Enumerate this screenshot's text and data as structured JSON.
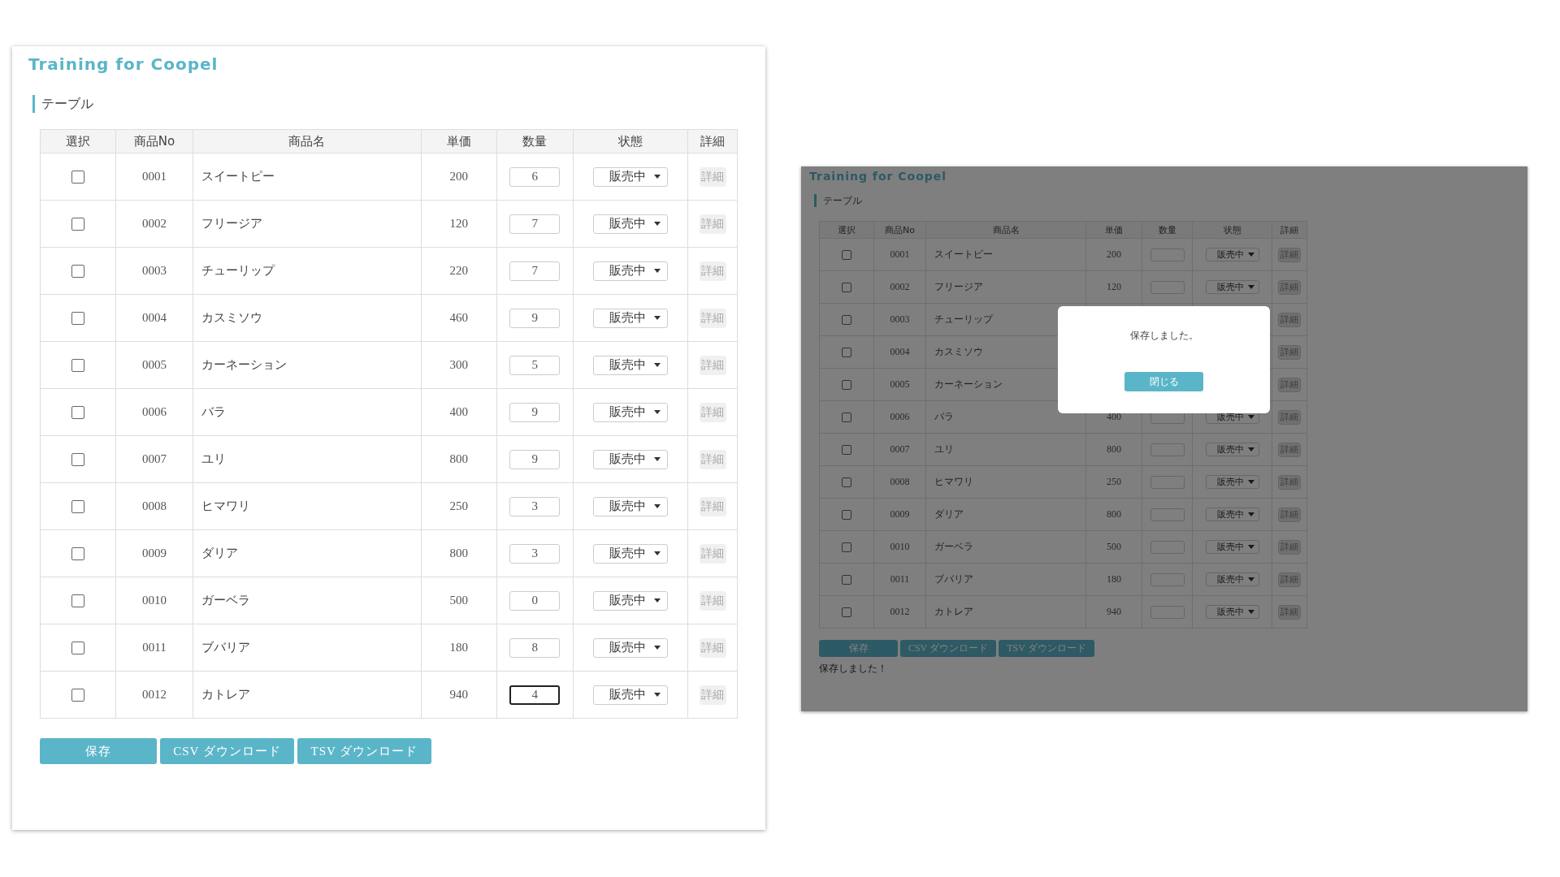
{
  "pages": [
    {
      "title": "Training for Coopel",
      "section": "テーブル",
      "columns": [
        "選択",
        "商品No",
        "商品名",
        "単価",
        "数量",
        "状態",
        "詳細"
      ],
      "rows": [
        {
          "kind": "full",
          "checked": false,
          "no": "0001",
          "name": "スイートピー",
          "price": "200",
          "quantity": "6",
          "focused": false,
          "status": "販売中",
          "detail": "詳細",
          "disabled": true
        },
        {
          "kind": "full",
          "checked": false,
          "no": "0002",
          "name": "フリージア",
          "price": "120",
          "quantity": "7",
          "focused": false,
          "status": "販売中",
          "detail": "詳細",
          "disabled": true
        },
        {
          "kind": "full",
          "checked": false,
          "no": "0003",
          "name": "チューリップ",
          "price": "220",
          "quantity": "7",
          "focused": false,
          "status": "販売中",
          "detail": "詳細",
          "disabled": true
        },
        {
          "kind": "full",
          "checked": false,
          "no": "0004",
          "name": "カスミソウ",
          "price": "460",
          "quantity": "9",
          "focused": false,
          "status": "販売中",
          "detail": "詳細",
          "disabled": true
        },
        {
          "kind": "full",
          "checked": false,
          "no": "0005",
          "name": "カーネーション",
          "price": "300",
          "quantity": "5",
          "focused": false,
          "status": "販売中",
          "detail": "詳細",
          "disabled": true
        },
        {
          "kind": "full",
          "checked": false,
          "no": "0006",
          "name": "バラ",
          "price": "400",
          "quantity": "9",
          "focused": false,
          "status": "販売中",
          "detail": "詳細",
          "disabled": true
        },
        {
          "kind": "full",
          "checked": false,
          "no": "0007",
          "name": "ユリ",
          "price": "800",
          "quantity": "9",
          "focused": false,
          "status": "販売中",
          "detail": "詳細",
          "disabled": true
        },
        {
          "kind": "full",
          "checked": false,
          "no": "0008",
          "name": "ヒマワリ",
          "price": "250",
          "quantity": "3",
          "focused": false,
          "status": "販売中",
          "detail": "詳細",
          "disabled": true
        },
        {
          "kind": "full",
          "checked": false,
          "no": "0009",
          "name": "ダリア",
          "price": "800",
          "quantity": "3",
          "focused": false,
          "status": "販売中",
          "detail": "詳細",
          "disabled": true
        },
        {
          "kind": "full",
          "checked": false,
          "no": "0010",
          "name": "ガーベラ",
          "price": "500",
          "quantity": "0",
          "focused": false,
          "status": "販売中",
          "detail": "詳細",
          "disabled": true
        },
        {
          "kind": "full",
          "checked": false,
          "no": "0011",
          "name": "ブバリア",
          "price": "180",
          "quantity": "8",
          "focused": false,
          "status": "販売中",
          "detail": "詳細",
          "disabled": true
        },
        {
          "kind": "full",
          "checked": false,
          "no": "0012",
          "name": "カトレア",
          "price": "940",
          "quantity": "4",
          "focused": true,
          "status": "販売中",
          "detail": "詳細",
          "disabled": true
        }
      ],
      "buttons": [
        "保存",
        "CSV ダウンロード",
        "TSV ダウンロード"
      ]
    },
    {
      "title": "Training for Coopel",
      "section": "テーブル",
      "columns": [
        "選択",
        "商品No",
        "商品名",
        "単価",
        "数量",
        "状態",
        "詳細"
      ],
      "rows": [
        {
          "kind": "full",
          "checked": false,
          "no": "0001",
          "name": "スイートピー",
          "price": "200",
          "focused": false,
          "status": "販売中",
          "detail": "詳細",
          "disabled": true
        },
        {
          "kind": "full",
          "checked": false,
          "no": "0002",
          "name": "フリージア",
          "price": "120",
          "focused": false,
          "status": "販売中",
          "detail": "詳細",
          "disabled": true
        },
        {
          "kind": "covered",
          "checked": false,
          "no": "0003",
          "name": "チューリップ",
          "detail": "詳細",
          "disabled": true
        },
        {
          "kind": "covered",
          "checked": false,
          "no": "0004",
          "name": "カスミソウ",
          "detail": "詳細",
          "disabled": true
        },
        {
          "kind": "covered",
          "checked": false,
          "no": "0005",
          "name": "カーネーション",
          "detail": "詳細",
          "disabled": true
        },
        {
          "kind": "full",
          "checked": false,
          "no": "0006",
          "name": "バラ",
          "price": "400",
          "focused": false,
          "status": "販売中",
          "detail": "詳細",
          "disabled": true
        },
        {
          "kind": "full",
          "checked": false,
          "no": "0007",
          "name": "ユリ",
          "price": "800",
          "focused": false,
          "status": "販売中",
          "detail": "詳細",
          "disabled": true
        },
        {
          "kind": "full",
          "checked": false,
          "no": "0008",
          "name": "ヒマワリ",
          "price": "250",
          "focused": false,
          "status": "販売中",
          "detail": "詳細",
          "disabled": true
        },
        {
          "kind": "full",
          "checked": false,
          "no": "0009",
          "name": "ダリア",
          "price": "800",
          "focused": false,
          "status": "販売中",
          "detail": "詳細",
          "disabled": true
        },
        {
          "kind": "full",
          "checked": false,
          "no": "0010",
          "name": "ガーベラ",
          "price": "500",
          "focused": false,
          "status": "販売中",
          "detail": "詳細",
          "disabled": true
        },
        {
          "kind": "full",
          "checked": false,
          "no": "0011",
          "name": "ブバリア",
          "price": "180",
          "focused": false,
          "status": "販売中",
          "detail": "詳細",
          "disabled": true
        },
        {
          "kind": "full",
          "checked": false,
          "no": "0012",
          "name": "カトレア",
          "price": "940",
          "focused": false,
          "status": "販売中",
          "detail": "詳細",
          "disabled": true
        }
      ],
      "buttons": [
        "保存",
        "CSV ダウンロード",
        "TSV ダウンロード"
      ],
      "message": "保存しました！",
      "modal": {
        "text": "保存しました。",
        "button": "閉じる"
      }
    }
  ]
}
